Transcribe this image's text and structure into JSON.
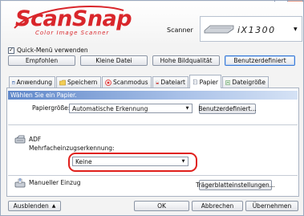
{
  "titlebar": {
    "help_symbol": "?",
    "close_symbol": "×"
  },
  "logo": {
    "text": "ScanSnap",
    "subtitle": "Color Image Scanner"
  },
  "scanner": {
    "label": "Scanner",
    "model": "iX1300"
  },
  "quick_menu": {
    "label": "Quick-Menü verwenden",
    "checked_mark": "✓"
  },
  "profiles": {
    "buttons": [
      "Empfohlen",
      "Kleine Datei",
      "Hohe Bildqualität",
      "Benutzerdefiniert"
    ]
  },
  "tabs": [
    {
      "label": "Anwendung"
    },
    {
      "label": "Speichern"
    },
    {
      "label": "Scanmodus"
    },
    {
      "label": "Dateiart"
    },
    {
      "label": "Papier"
    },
    {
      "label": "Dateigröße"
    }
  ],
  "paper_panel": {
    "info": "Wählen Sie ein Papier.",
    "paper_size_label": "Papiergröße:",
    "paper_size_value": "Automatische Erkennung",
    "custom_button": "Benutzerdefiniert...",
    "adf_label": "ADF",
    "multifeed_label": "Mehrfacheinzugserkennung:",
    "multifeed_value": "Keine",
    "manual_feed_label": "Manueller Einzug",
    "carrier_button": "Trägerblatteinstellungen..."
  },
  "footer": {
    "hide_button": "Ausblenden",
    "ok_button": "OK",
    "cancel_button": "Abbrechen",
    "apply_button": "Übernehmen"
  },
  "colors": {
    "brand_red": "#d9262b",
    "info_bar_blue": "#5f87c9",
    "highlight_red": "#e0201c"
  }
}
